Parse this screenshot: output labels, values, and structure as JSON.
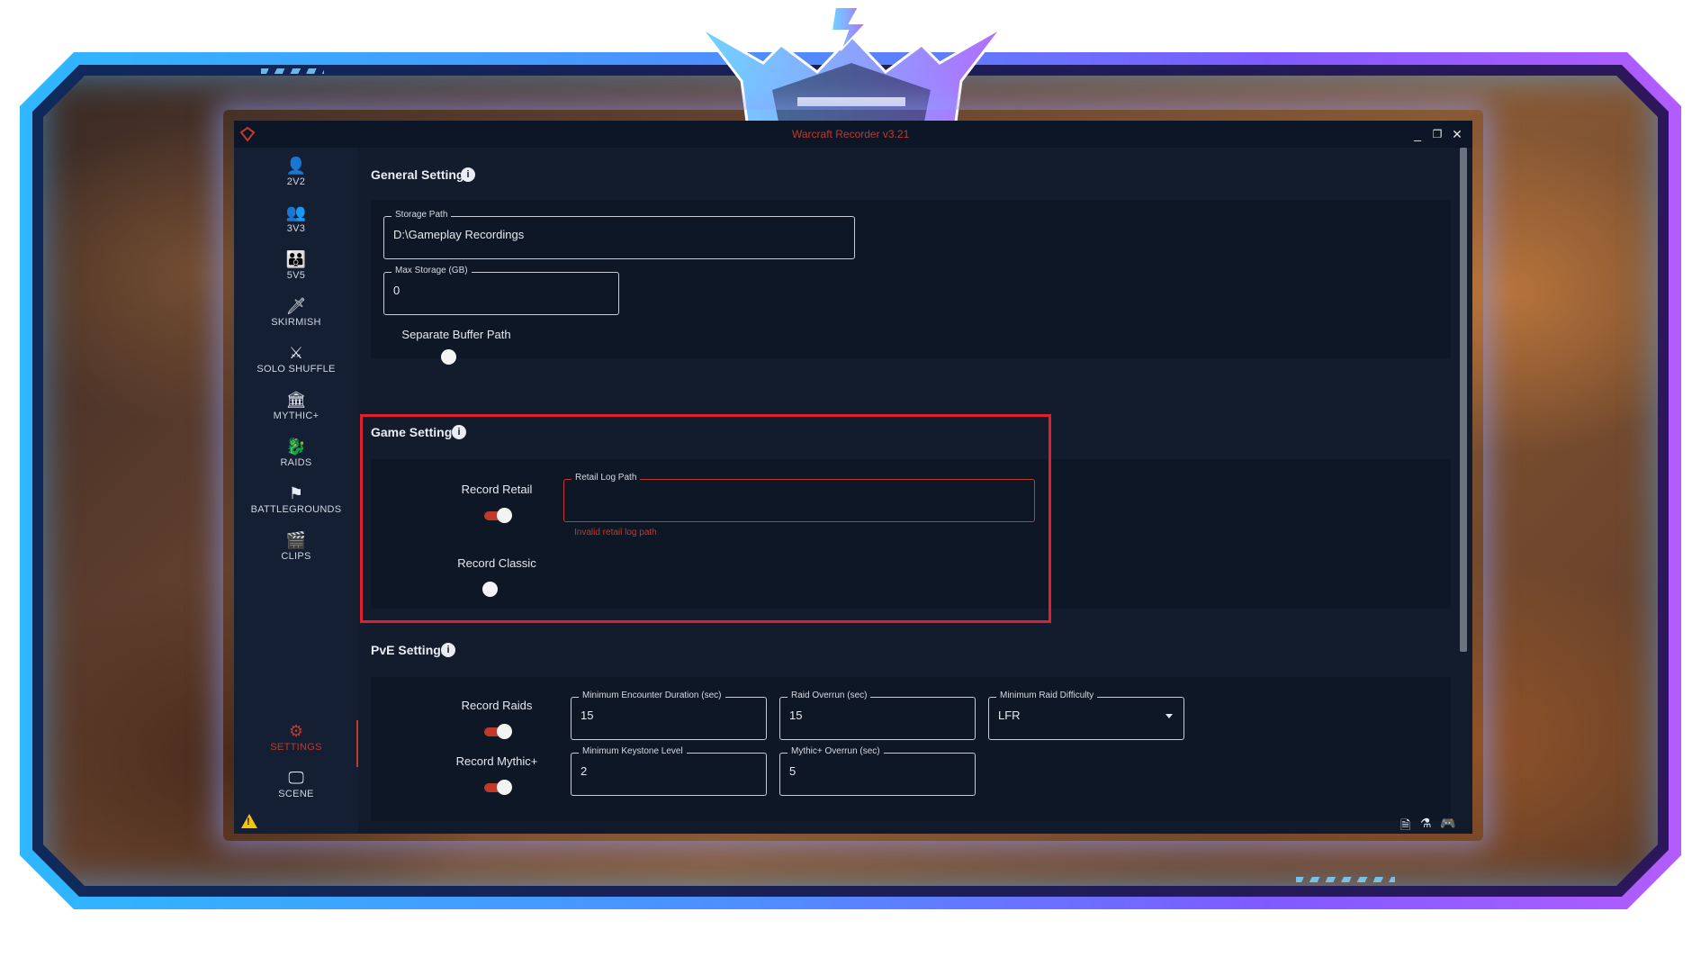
{
  "window": {
    "title": "Warcraft Recorder v3.21",
    "minimize": "_",
    "restore": "❐",
    "close": "✕"
  },
  "sidebar": {
    "items": [
      {
        "label": "2V2",
        "icon": "two-person-icon",
        "glyph": "👤"
      },
      {
        "label": "3V3",
        "icon": "three-person-icon",
        "glyph": "👥"
      },
      {
        "label": "5V5",
        "icon": "five-person-icon",
        "glyph": "👪"
      },
      {
        "label": "SKIRMISH",
        "icon": "sword-icon",
        "glyph": "🗡"
      },
      {
        "label": "SOLO SHUFFLE",
        "icon": "crossed-swords-icon",
        "glyph": "⚔"
      },
      {
        "label": "MYTHIC+",
        "icon": "castle-icon",
        "glyph": "🏛"
      },
      {
        "label": "RAIDS",
        "icon": "dragon-icon",
        "glyph": "🐉"
      },
      {
        "label": "BATTLEGROUNDS",
        "icon": "flag-icon",
        "glyph": "⚑"
      },
      {
        "label": "CLIPS",
        "icon": "clapperboard-icon",
        "glyph": "🎬"
      }
    ],
    "settings": {
      "label": "SETTINGS",
      "icon": "gear-icon",
      "glyph": "⚙"
    },
    "scene": {
      "label": "SCENE",
      "icon": "monitor-icon",
      "glyph": "🖵"
    }
  },
  "general": {
    "title": "General Settings",
    "storage_path_label": "Storage Path",
    "storage_path_value": "D:\\Gameplay Recordings",
    "max_storage_label": "Max Storage (GB)",
    "max_storage_value": "0",
    "separate_buffer_label": "Separate Buffer Path",
    "separate_buffer_on": false
  },
  "game": {
    "title": "Game Settings",
    "record_retail_label": "Record Retail",
    "record_retail_on": true,
    "retail_log_path_label": "Retail Log Path",
    "retail_log_path_value": "",
    "retail_log_path_error": "Invalid retail log path",
    "record_classic_label": "Record Classic",
    "record_classic_on": false
  },
  "pve": {
    "title": "PvE Settings",
    "record_raids_label": "Record Raids",
    "record_raids_on": true,
    "record_mythic_label": "Record Mythic+",
    "record_mythic_on": true,
    "min_encounter_label": "Minimum Encounter Duration (sec)",
    "min_encounter_value": "15",
    "raid_overrun_label": "Raid Overrun (sec)",
    "raid_overrun_value": "15",
    "min_raid_difficulty_label": "Minimum Raid Difficulty",
    "min_raid_difficulty_value": "LFR",
    "min_keystone_label": "Minimum Keystone Level",
    "min_keystone_value": "2",
    "mythic_overrun_label": "Mythic+ Overrun (sec)",
    "mythic_overrun_value": "5"
  },
  "colors": {
    "accent": "#c0392b",
    "highlight": "#e0202d",
    "bg": "#131c2c"
  }
}
